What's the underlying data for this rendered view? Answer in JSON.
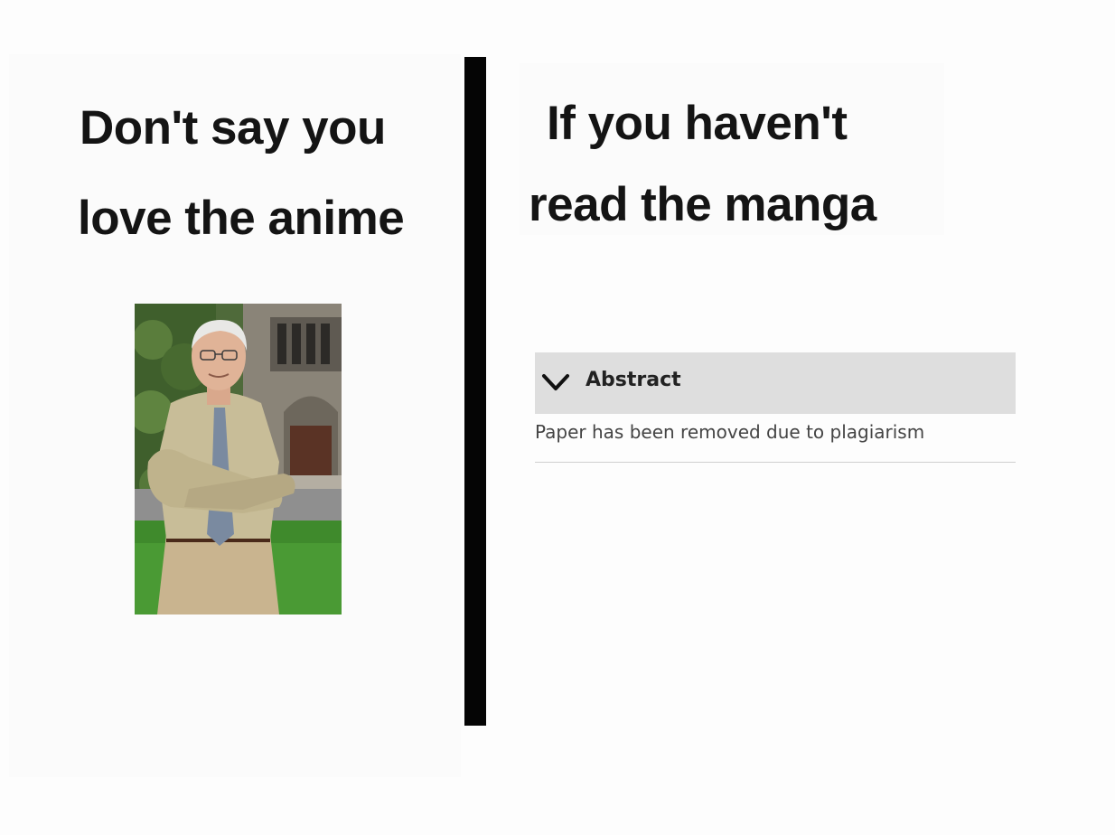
{
  "left": {
    "line1": "Don't say you",
    "line2": "love the anime"
  },
  "right": {
    "line1": "If you haven't",
    "line2": "read the manga"
  },
  "abstract": {
    "title": "Abstract",
    "body": "Paper has been removed due to plagiarism"
  },
  "icons": {
    "chevron": "chevron-down-icon"
  }
}
